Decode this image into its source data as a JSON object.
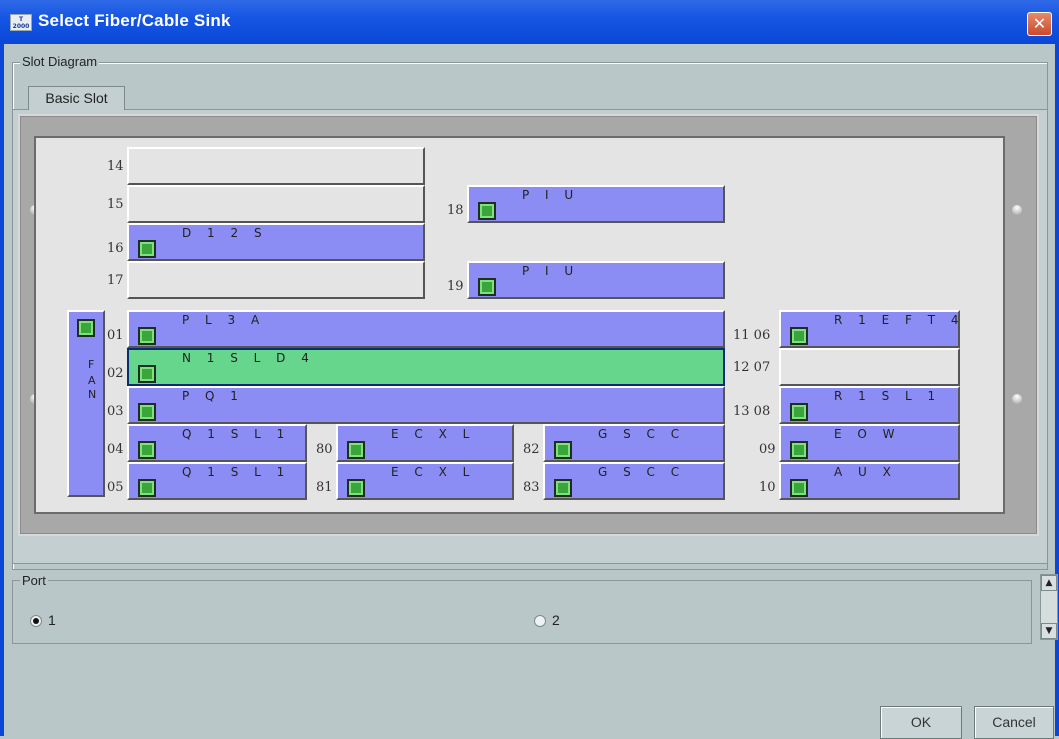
{
  "window": {
    "title": "Select Fiber/Cable Sink",
    "icon_text": "T 2000",
    "close_glyph": "✕"
  },
  "slot_diagram": {
    "group_label": "Slot Diagram",
    "tab_label": "Basic Slot",
    "fan_letters": [
      "F",
      "A",
      "N"
    ],
    "slots": [
      {
        "num": "14",
        "name": "",
        "led": false,
        "state": "empty"
      },
      {
        "num": "15",
        "name": "",
        "led": false,
        "state": "empty"
      },
      {
        "num": "16",
        "name": "D 1 2 S",
        "led": true,
        "state": "occupied"
      },
      {
        "num": "17",
        "name": "",
        "led": false,
        "state": "empty"
      },
      {
        "num": "18",
        "name": "P I U",
        "led": true,
        "state": "occupied"
      },
      {
        "num": "19",
        "name": "P I U",
        "led": true,
        "state": "occupied"
      },
      {
        "num": "01",
        "name": "P L 3 A",
        "led": true,
        "state": "occupied"
      },
      {
        "num": "02",
        "name": "N 1 S L D 4",
        "led": true,
        "state": "selected"
      },
      {
        "num": "03",
        "name": "P Q 1",
        "led": true,
        "state": "occupied"
      },
      {
        "num": "04",
        "name": "Q 1 S L 1",
        "led": true,
        "state": "occupied"
      },
      {
        "num": "05",
        "name": "Q 1 S L 1",
        "led": true,
        "state": "occupied"
      },
      {
        "num": "80",
        "name": "E C X L",
        "led": true,
        "state": "occupied"
      },
      {
        "num": "81",
        "name": "E C X L",
        "led": true,
        "state": "occupied"
      },
      {
        "num": "82",
        "name": "G S C C",
        "led": true,
        "state": "occupied"
      },
      {
        "num": "83",
        "name": "G S C C",
        "led": true,
        "state": "occupied"
      },
      {
        "num": "11 06",
        "name": "R 1 E F T 4",
        "led": true,
        "state": "occupied"
      },
      {
        "num": "12 07",
        "name": "",
        "led": false,
        "state": "empty"
      },
      {
        "num": "13 08",
        "name": "R 1 S L 1",
        "led": true,
        "state": "occupied"
      },
      {
        "num": "09",
        "name": "E O W",
        "led": true,
        "state": "occupied"
      },
      {
        "num": "10",
        "name": "A U X",
        "led": true,
        "state": "occupied"
      }
    ]
  },
  "port": {
    "group_label": "Port",
    "options": [
      {
        "label": "1",
        "checked": true
      },
      {
        "label": "2",
        "checked": false
      }
    ]
  },
  "buttons": {
    "ok": "OK",
    "cancel": "Cancel"
  },
  "scrollbar": {
    "up": "▲",
    "down": "▼"
  },
  "colors": {
    "occupied": "#8c8cf5",
    "selected": "#66d68c",
    "empty": "#e4e4e4",
    "led": "#3aa53a",
    "title_bar": "#1656e3"
  }
}
